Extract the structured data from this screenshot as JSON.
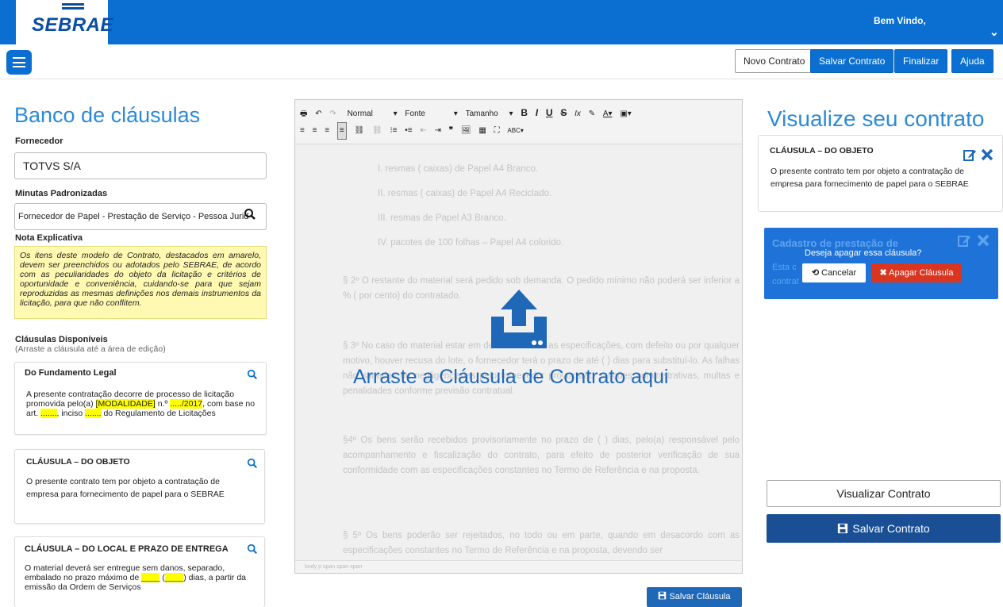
{
  "header": {
    "logo": "SEBRAE",
    "welcome": "Bem Vindo,",
    "user_chevron": "⌄"
  },
  "toolbar": {
    "buttons": [
      "Novo Contrato",
      "Salvar Contrato",
      "Finalizar",
      "Ajuda"
    ]
  },
  "left": {
    "title": "Banco de cláusulas",
    "fornecedor_label": "Fornecedor",
    "fornecedor_value": "TOTVS S/A",
    "minutas_label": "Minutas Padronizadas",
    "minutas_value": "Fornecedor de Papel - Prestação de Serviço - Pessoa Jurid",
    "nota_label": "Nota Explicativa",
    "nota_text": "Os itens deste modelo de Contrato, destacados em amarelo, devem ser preenchidos ou adotados pelo SEBRAE, de acordo com as peculiaridades do objeto da licitação e critérios de oportunidade e conveniência, cuidando-se para que sejam reproduzidas as mesmas definições nos demais instrumentos da licitação, para que não conflitem.",
    "clausulas_label": "Cláusulas Disponíveis",
    "clausulas_hint": "(Arraste a cláusula até a área de edição)",
    "cards": [
      {
        "title": "Do Fundamento Legal",
        "t1": "A presente contratação decorre de processo de licitação promovida pelo(a) ",
        "hl1": "[MODALIDADE]",
        "t2": " n.º ",
        "hl2": "...../2017",
        "t3": ", com base no art. ",
        "hl3": ".......",
        "t4": ", inciso ",
        "hl4": ".......",
        "t5": " do Regulamento de Licitações"
      },
      {
        "title": "CLÁUSULA – DO OBJETO",
        "text": "O presente contrato tem por objeto a contratação de empresa para fornecimento de papel para o SEBRAE"
      },
      {
        "title": "CLÁUSULA – DO LOCAL E PRAZO DE ENTREGA",
        "t1": "O material deverá ser entregue sem danos, separado, embalado no prazo máximo de ",
        "hl1": "____",
        "t2": " (",
        "hl2": "____",
        "t3": ") dias, a partir da emissão da Ordem de Serviços"
      }
    ]
  },
  "editor": {
    "row1": [
      "🖶",
      "↶",
      "↷",
      "Normal",
      "▾",
      "Fonte",
      "▾",
      "Tamanho",
      "▾",
      "B",
      "I",
      "U",
      "S",
      "Ix",
      "✎",
      "A▾",
      "▣▾"
    ],
    "row2": [
      "≡",
      "≡",
      "≡",
      "≡",
      "⛓",
      "⛓",
      "⁝≡",
      "•≡",
      "⇤",
      "⇥",
      "❞",
      "🖼",
      "▦",
      "⛶",
      "ABC▾"
    ],
    "ghost_lines": [
      "I.          resmas (        caixas) de Papel A4 Branco.",
      "II.         resmas (        caixas) de Papel A4 Reciclado.",
      "III.        resmas de Papel A3 Branco.",
      "IV.         pacotes de 100 folhas – Papel A4 colorido."
    ],
    "ghost_p1": "§ 2º O restante do material será pedido sob demanda. O pedido mínimo não poderá ser inferior a     % (         por cento) do contratado.",
    "ghost_p2": "§ 3º No caso do material estar em desacordo com as especificações, com defeito ou por qualquer motivo, houver recusa do lote, o fornecedor terá o prazo de até        (       ) dias para substituí-lo. As falhas não sanadas ou negligenciadas pelo fornecedor provocarão sanções administrativas, multas e penalidades conforme previsão contratual.",
    "ghost_p3": "§4º Os bens serão recebidos provisoriamente no prazo de       (      ) dias, pelo(a) responsável pelo acompanhamento e fiscalização do contrato, para efeito de posterior verificação de sua conformidade com as especificações constantes no Termo de Referência e na proposta.",
    "ghost_p4": "§ 5º Os bens poderão ser rejeitados, no todo ou em parte, quando em desacordo com as especificações constantes no Termo de Referência e na proposta, devendo ser",
    "drop_text": "Arraste a Cláusula de Contrato aqui",
    "status": "body  p  span  span  span",
    "save_clause": "Salvar Cláusula"
  },
  "right": {
    "title": "Visualize seu contrato",
    "preview_title": "CLÁUSULA – DO OBJETO",
    "preview_text": "O presente contrato tem por objeto a contratação de empresa para fornecimento de papel para o SEBRAE",
    "blue_title": "Cadastro de prestação de",
    "blue_text1": "Esta c",
    "blue_text2": "contrat",
    "popup_question": "Deseja apagar essa cláusula?",
    "cancel_label": "Cancelar",
    "delete_label": "Apagar Cláusula",
    "view_button": "Visualizar Contrato",
    "save_button": "Salvar Contrato"
  },
  "colors": {
    "primary": "#0a6fd1",
    "dark_blue": "#1a4f95",
    "highlight": "#ffff00",
    "danger": "#d9351f",
    "note_bg": "#fff9b1"
  }
}
